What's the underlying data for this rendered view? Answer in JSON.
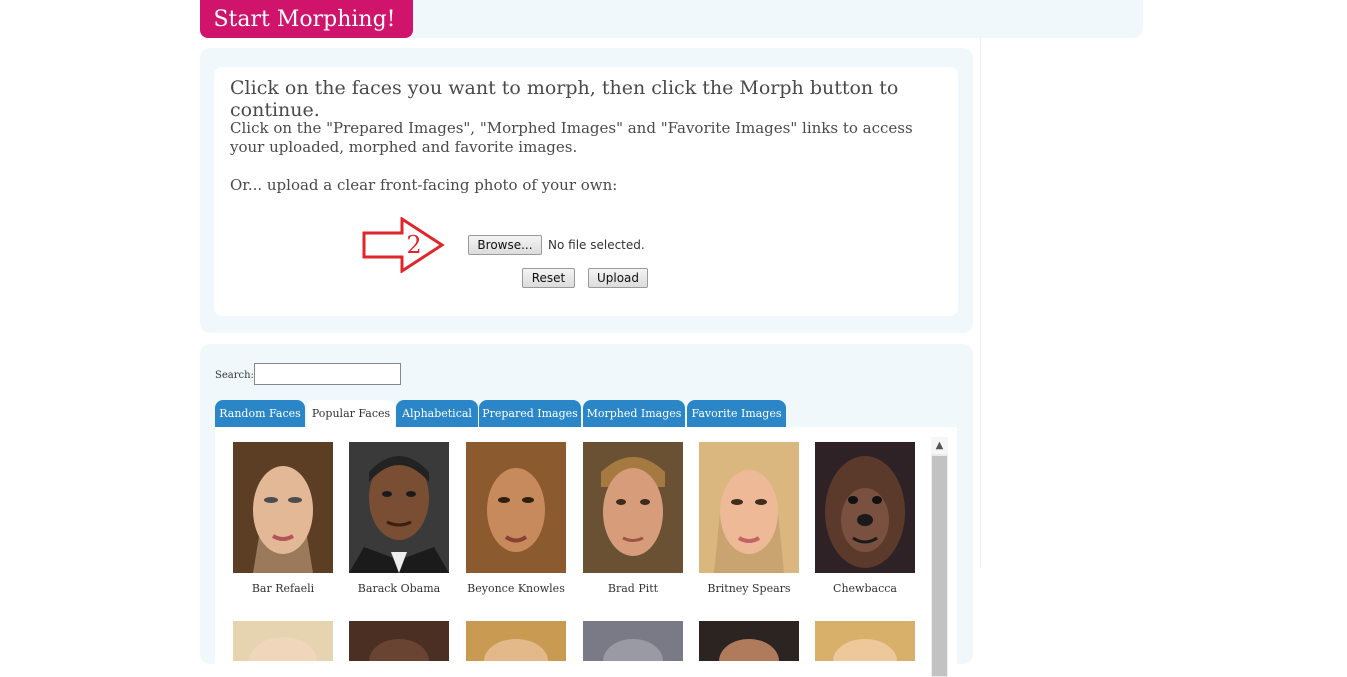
{
  "header": {
    "start_label": "Start Morphing!"
  },
  "upload_panel": {
    "headline": "Click on the faces you want to morph, then click the Morph button to continue.",
    "paragraph1": "Click on the \"Prepared Images\", \"Morphed Images\" and \"Favorite Images\" links to access your uploaded, morphed and favorite images.",
    "paragraph2": "Or... upload a clear front-facing photo of your own:",
    "annotation_number": "2",
    "browse_label": "Browse...",
    "file_status": "No file selected.",
    "reset_label": "Reset",
    "upload_label": "Upload"
  },
  "search": {
    "label": "Search:",
    "value": ""
  },
  "tabs": [
    {
      "label": "Random Faces",
      "active": false
    },
    {
      "label": "Popular Faces",
      "active": true
    },
    {
      "label": "Alphabetical",
      "active": false
    },
    {
      "label": "Prepared Images",
      "active": false
    },
    {
      "label": "Morphed Images",
      "active": false
    },
    {
      "label": "Favorite Images",
      "active": false
    }
  ],
  "faces": [
    {
      "name": "Bar Refaeli"
    },
    {
      "name": "Barack Obama"
    },
    {
      "name": "Beyonce Knowles"
    },
    {
      "name": "Brad Pitt"
    },
    {
      "name": "Britney Spears"
    },
    {
      "name": "Chewbacca"
    }
  ],
  "colors": {
    "accent_pink": "#d0136b",
    "tab_blue": "#2a86c7",
    "panel_bg": "#f1f8fc",
    "arrow_red": "#e0262b"
  }
}
